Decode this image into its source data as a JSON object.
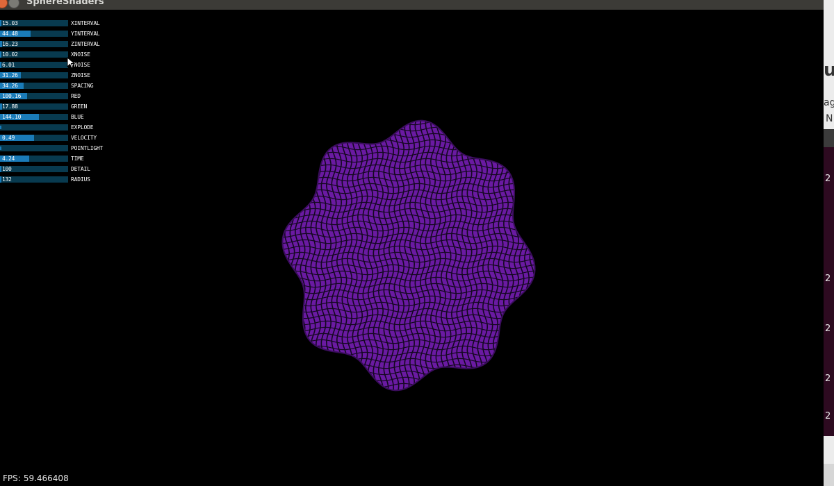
{
  "window": {
    "title": "SphereShaders"
  },
  "controls": [
    {
      "value": "15.03",
      "label": "XINTERVAL",
      "level": 0.02
    },
    {
      "value": "44.48",
      "label": "YINTERVAL",
      "level": 0.45
    },
    {
      "value": "16.23",
      "label": "ZINTERVAL",
      "level": 0.03
    },
    {
      "value": "10.02",
      "label": "XNOISE",
      "level": 0.02
    },
    {
      "value": "6.01",
      "label": "YNOISE",
      "level": 0.02
    },
    {
      "value": "31.26",
      "label": "ZNOISE",
      "level": 0.31
    },
    {
      "value": "34.26",
      "label": "SPACING",
      "level": 0.35
    },
    {
      "value": "100.16",
      "label": "RED",
      "level": 0.4
    },
    {
      "value": "17.88",
      "label": "GREEN",
      "level": 0.03
    },
    {
      "value": "144.10",
      "label": "BLUE",
      "level": 0.57
    },
    {
      "value": "",
      "label": "EXPLODE",
      "level": 0
    },
    {
      "value": "0.49",
      "label": "VELOCITY",
      "level": 0.5
    },
    {
      "value": "",
      "label": "POINTLIGHT",
      "level": 0
    },
    {
      "value": "4.24",
      "label": "TIME",
      "level": 0.43
    },
    {
      "value": "100",
      "label": "DETAIL",
      "level": 0.02
    },
    {
      "value": "132",
      "label": "RADIUS",
      "level": 0.02
    }
  ],
  "fps": {
    "label": "FPS:",
    "value": "59.466408"
  },
  "sphere": {
    "fill_color": "#6a1aa2",
    "line_color": "#140820"
  },
  "colors": {
    "slider_track": "#083a4f",
    "slider_fill": "#1a7bb8"
  },
  "background_window": {
    "heading_fragment": "u",
    "line1_fragment": "ag",
    "line2_fragment": "N",
    "row_values": [
      "2",
      "2",
      "2",
      "2",
      "2"
    ]
  }
}
